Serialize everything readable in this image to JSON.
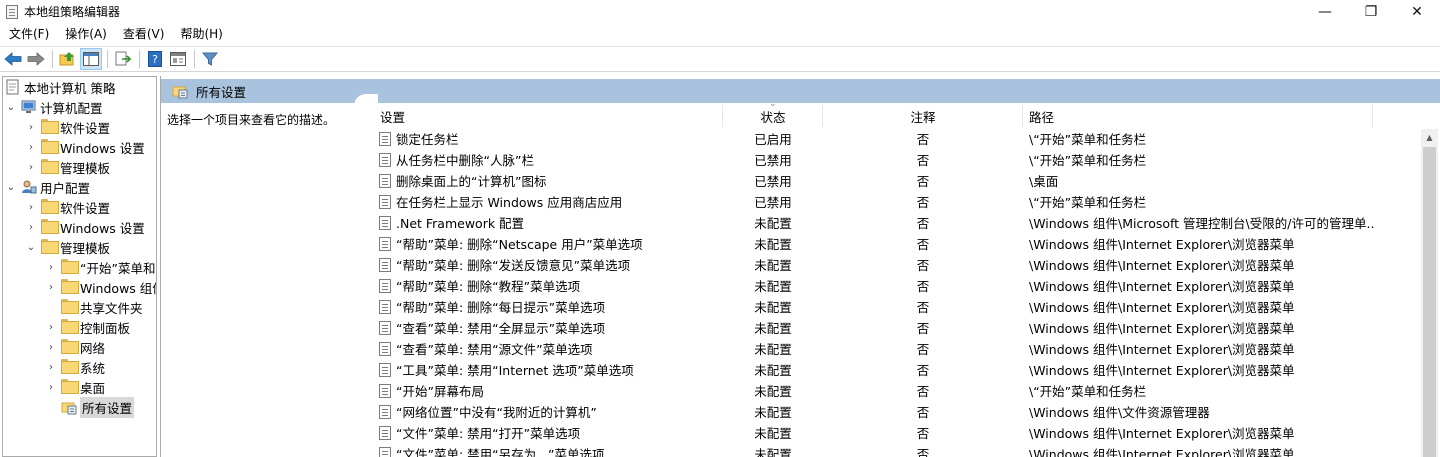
{
  "window": {
    "title": "本地组策略编辑器",
    "controls": {
      "minimize": "—",
      "maximize": "❐",
      "close": "✕"
    }
  },
  "menu": [
    "文件(F)",
    "操作(A)",
    "查看(V)",
    "帮助(H)"
  ],
  "toolbar": [
    "back-icon",
    "forward-icon",
    "up-folder-icon",
    "show-hide-tree-icon",
    "export-list-icon",
    "help-icon",
    "properties-icon",
    "filter-icon"
  ],
  "tree": {
    "root": "本地计算机 策略",
    "items": [
      {
        "label": "计算机配置",
        "chev": "⌄"
      },
      {
        "label": "软件设置",
        "chev": "›"
      },
      {
        "label": "Windows 设置",
        "chev": "›"
      },
      {
        "label": "管理模板",
        "chev": "›"
      },
      {
        "label": "用户配置",
        "chev": "⌄"
      },
      {
        "label": "软件设置",
        "chev": "›"
      },
      {
        "label": "Windows 设置",
        "chev": "›"
      },
      {
        "label": "管理模板",
        "chev": "⌄"
      },
      {
        "label": "“开始”菜单和",
        "chev": "›"
      },
      {
        "label": "Windows 组件",
        "chev": "›"
      },
      {
        "label": "共享文件夹",
        "chev": ""
      },
      {
        "label": "控制面板",
        "chev": "›"
      },
      {
        "label": "网络",
        "chev": "›"
      },
      {
        "label": "系统",
        "chev": "›"
      },
      {
        "label": "桌面",
        "chev": "›"
      },
      {
        "label": "所有设置",
        "chev": ""
      }
    ]
  },
  "pane": {
    "header": "所有设置",
    "description": "选择一个项目来查看它的描述。"
  },
  "columns": {
    "setting": "设置",
    "state": "状态",
    "comment": "注释",
    "path": "路径"
  },
  "rows": [
    {
      "setting": "锁定任务栏",
      "state": "已启用",
      "comment": "否",
      "path": "\\“开始”菜单和任务栏"
    },
    {
      "setting": "从任务栏中删除“人脉”栏",
      "state": "已禁用",
      "comment": "否",
      "path": "\\“开始”菜单和任务栏"
    },
    {
      "setting": "删除桌面上的“计算机”图标",
      "state": "已禁用",
      "comment": "否",
      "path": "\\桌面"
    },
    {
      "setting": "在任务栏上显示 Windows 应用商店应用",
      "state": "已禁用",
      "comment": "否",
      "path": "\\“开始”菜单和任务栏"
    },
    {
      "setting": ".Net Framework 配置",
      "state": "未配置",
      "comment": "否",
      "path": "\\Windows 组件\\Microsoft 管理控制台\\受限的/许可的管理单..."
    },
    {
      "setting": "“帮助”菜单: 删除“Netscape 用户”菜单选项",
      "state": "未配置",
      "comment": "否",
      "path": "\\Windows 组件\\Internet Explorer\\浏览器菜单"
    },
    {
      "setting": "“帮助”菜单: 删除“发送反馈意见”菜单选项",
      "state": "未配置",
      "comment": "否",
      "path": "\\Windows 组件\\Internet Explorer\\浏览器菜单"
    },
    {
      "setting": "“帮助”菜单: 删除“教程”菜单选项",
      "state": "未配置",
      "comment": "否",
      "path": "\\Windows 组件\\Internet Explorer\\浏览器菜单"
    },
    {
      "setting": "“帮助”菜单: 删除“每日提示”菜单选项",
      "state": "未配置",
      "comment": "否",
      "path": "\\Windows 组件\\Internet Explorer\\浏览器菜单"
    },
    {
      "setting": "“查看”菜单: 禁用“全屏显示”菜单选项",
      "state": "未配置",
      "comment": "否",
      "path": "\\Windows 组件\\Internet Explorer\\浏览器菜单"
    },
    {
      "setting": "“查看”菜单: 禁用“源文件”菜单选项",
      "state": "未配置",
      "comment": "否",
      "path": "\\Windows 组件\\Internet Explorer\\浏览器菜单"
    },
    {
      "setting": "“工具”菜单: 禁用“Internet 选项”菜单选项",
      "state": "未配置",
      "comment": "否",
      "path": "\\Windows 组件\\Internet Explorer\\浏览器菜单"
    },
    {
      "setting": "“开始”屏幕布局",
      "state": "未配置",
      "comment": "否",
      "path": "\\“开始”菜单和任务栏"
    },
    {
      "setting": "“网络位置”中没有“我附近的计算机”",
      "state": "未配置",
      "comment": "否",
      "path": "\\Windows 组件\\文件资源管理器"
    },
    {
      "setting": "“文件”菜单: 禁用“打开”菜单选项",
      "state": "未配置",
      "comment": "否",
      "path": "\\Windows 组件\\Internet Explorer\\浏览器菜单"
    },
    {
      "setting": "“文件”菜单: 禁用“另存为...”菜单选项",
      "state": "未配置",
      "comment": "否",
      "path": "\\Windows 组件\\Internet Explorer\\浏览器菜单"
    }
  ]
}
